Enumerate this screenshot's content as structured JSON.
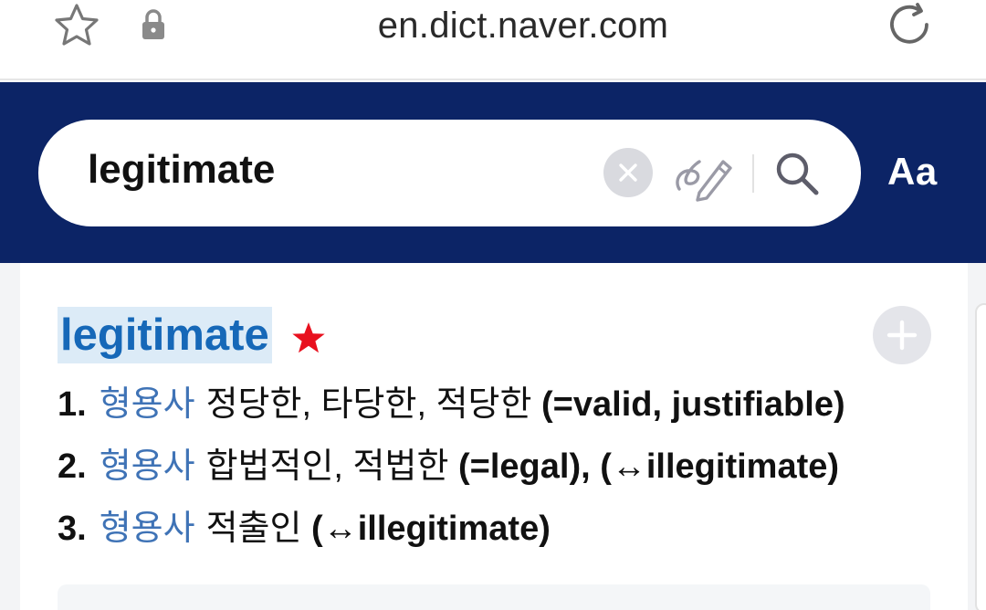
{
  "browser": {
    "url": "en.dict.naver.com",
    "icons": {
      "bookmark": "star-outline-icon",
      "secure": "lock-icon",
      "reload": "reload-icon"
    }
  },
  "header": {
    "search": {
      "query": "legitimate"
    },
    "icons": {
      "clear": "clear-icon",
      "handwriting": "handwriting-pen-icon",
      "search": "search-icon"
    },
    "font_button_label": "Aa",
    "colors": {
      "background": "#0c2466"
    }
  },
  "entry": {
    "headword": "legitimate",
    "senses": [
      {
        "num": "1.",
        "pos": "형용사",
        "meaning": "정당한, 타당한, 적당한",
        "syn": "(=valid, justifiable)"
      },
      {
        "num": "2.",
        "pos": "형용사",
        "meaning": "합법적인, 적법한",
        "syn": "(=legal), (↔illegitimate)"
      },
      {
        "num": "3.",
        "pos": "형용사",
        "meaning": "적출인",
        "syn": "(↔illegitimate)"
      }
    ],
    "colors": {
      "headword": "#1668b8",
      "highlight": "#dcebf7",
      "pos": "#3f73b6",
      "star": "#e8101e"
    },
    "icons": {
      "favorite": "star-filled-icon",
      "add": "plus-icon"
    }
  }
}
